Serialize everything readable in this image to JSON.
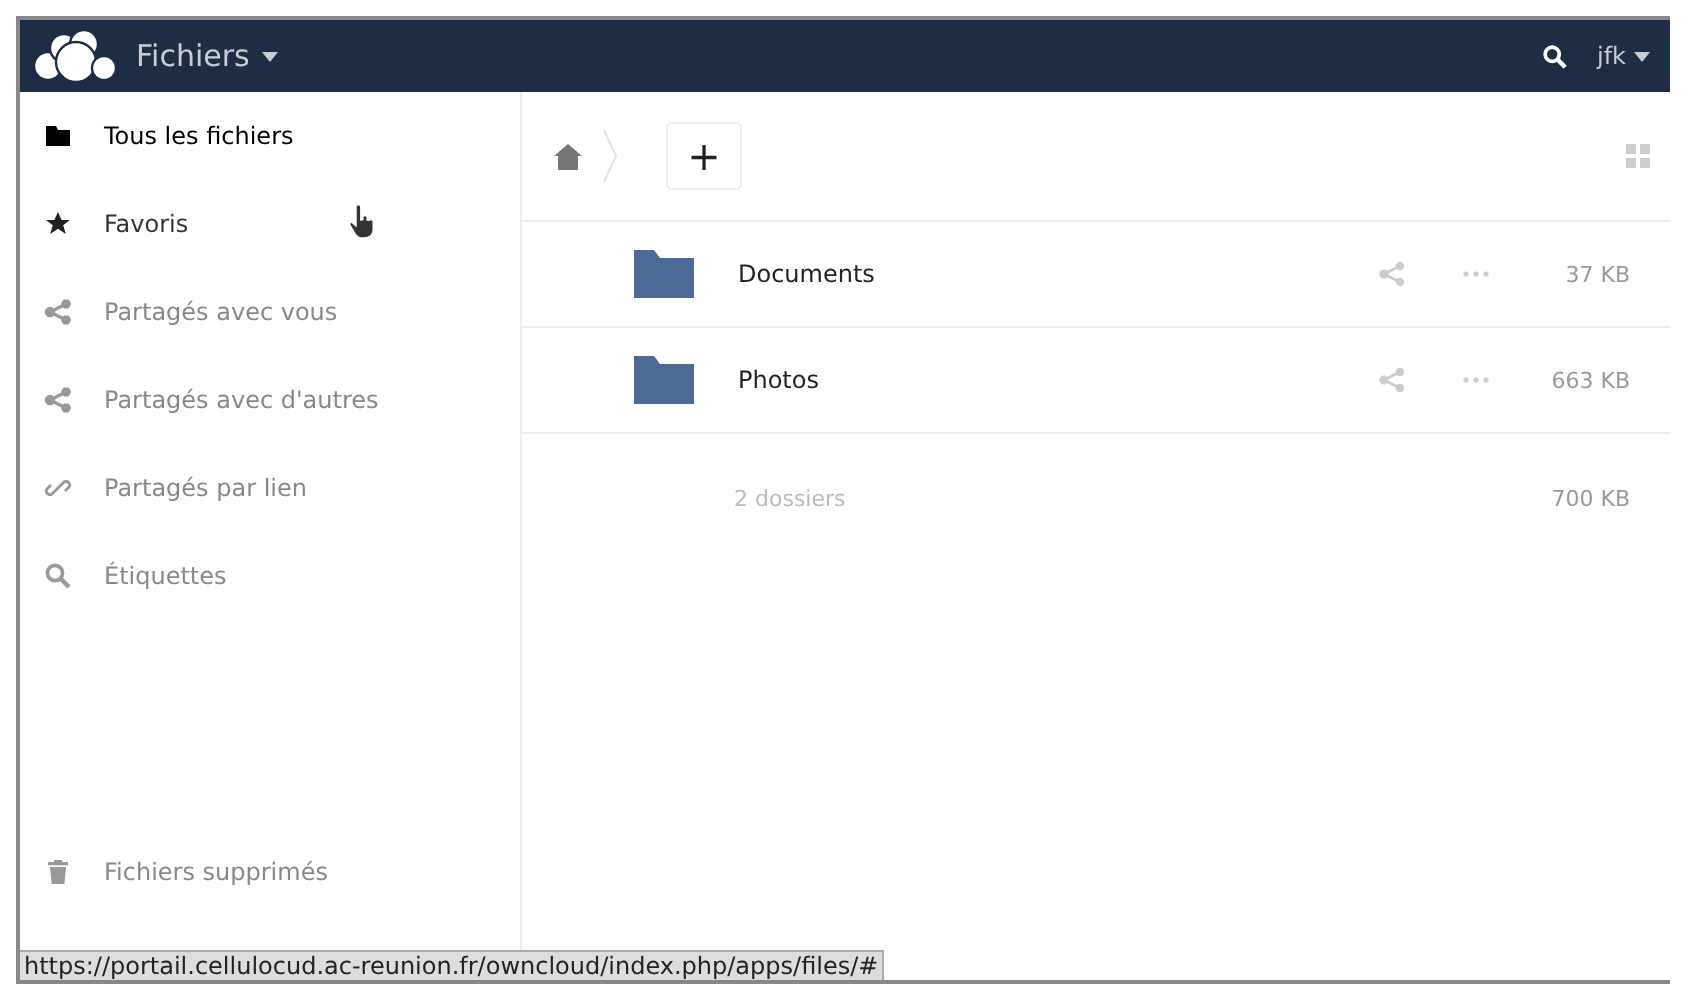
{
  "header": {
    "app_title": "Fichiers",
    "user": "jfk"
  },
  "sidebar": {
    "items": [
      {
        "label": "Tous les fichiers",
        "kind": "folder",
        "selected": true,
        "hovered": false
      },
      {
        "label": "Favoris",
        "kind": "star",
        "selected": false,
        "hovered": true
      },
      {
        "label": "Partagés avec vous",
        "kind": "share",
        "selected": false,
        "hovered": false
      },
      {
        "label": "Partagés avec d'autres",
        "kind": "share",
        "selected": false,
        "hovered": false
      },
      {
        "label": "Partagés par lien",
        "kind": "link",
        "selected": false,
        "hovered": false
      },
      {
        "label": "Étiquettes",
        "kind": "tag",
        "selected": false,
        "hovered": false
      }
    ],
    "bottom_items": [
      {
        "label": "Fichiers supprimés",
        "kind": "trash",
        "selected": false,
        "hovered": false
      }
    ]
  },
  "toolbar": {
    "new_button": "+"
  },
  "files": [
    {
      "name": "Documents",
      "size": "37 KB"
    },
    {
      "name": "Photos",
      "size": "663 KB"
    }
  ],
  "summary": {
    "count": "2 dossiers",
    "size": "700 KB"
  },
  "status_bar": {
    "url": "https://portail.cellulocud.ac-reunion.fr/owncloud/index.php/apps/files/#"
  }
}
